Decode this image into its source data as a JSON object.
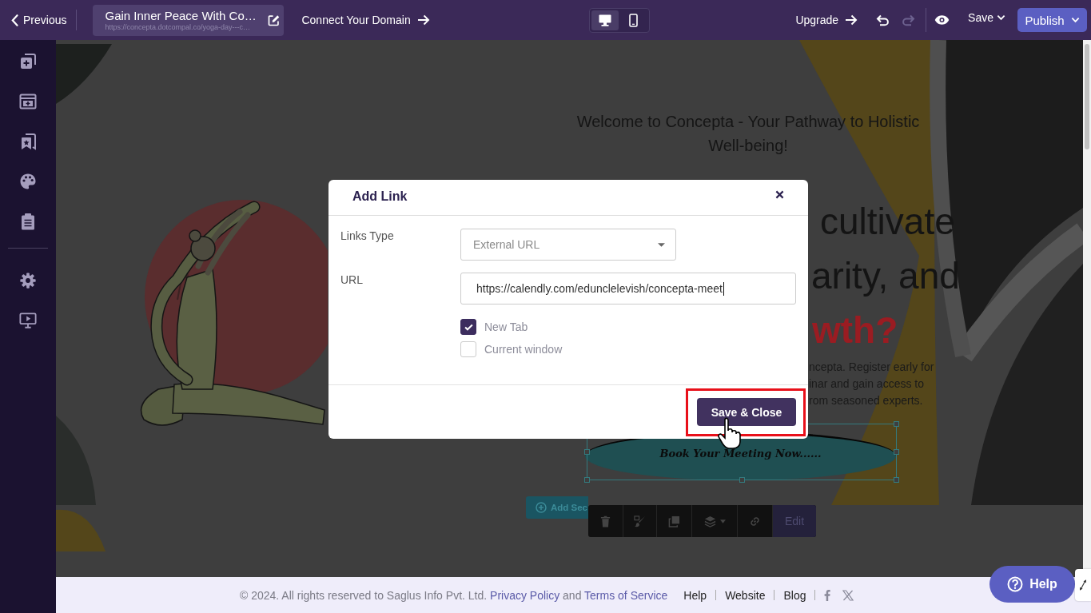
{
  "topbar": {
    "back": {
      "label": "Previous"
    },
    "page": {
      "title": "Gain Inner Peace With Co…",
      "url": "https://concepta.dotcompal.co/yoga-day---c…"
    },
    "domain_link": {
      "label": "Connect Your Domain"
    },
    "devices": [
      {
        "selected": true
      },
      {
        "selected": false
      }
    ],
    "upgrade": {
      "label": "Upgrade"
    },
    "history": [
      {
        "disabled": false
      },
      {
        "disabled": true
      }
    ],
    "save": {
      "label": "Save"
    },
    "publish": {
      "label": "Publish"
    }
  },
  "canvas": {
    "heading": "Welcome to Concepta - Your Pathway to Holistic Well-being!",
    "title_fragments": [
      {
        "kind": "plain",
        "text": "cultivate"
      },
      {
        "kind": "plain",
        "text": "arity, and"
      },
      {
        "kind": "accent",
        "text": "wth?"
      }
    ],
    "description_fragments": [
      "ncepta. Register early for",
      "inar and gain access to",
      "rom seasoned experts."
    ],
    "cta": {
      "label": "Book Your Meeting Now......",
      "selected": true
    },
    "add_section": {
      "label": "Add Sec"
    },
    "edit_button": {
      "label": "Edit"
    }
  },
  "modal": {
    "title": "Add Link",
    "fields": [
      {
        "kind": "select",
        "label": "Links Type",
        "value": "External URL"
      },
      {
        "kind": "text",
        "label": "URL",
        "value": "https://calendly.com/edunclelevish/concepta-meet"
      }
    ],
    "options": [
      {
        "label": "New Tab",
        "checked": true
      },
      {
        "label": "Current window",
        "checked": false
      }
    ],
    "primary_button": {
      "label": "Save & Close",
      "highlighted": true
    }
  },
  "footer": {
    "copyright": [
      {
        "kind": "text",
        "text": "© 2024. All rights reserved to Saglus Info Pvt. Ltd."
      },
      {
        "kind": "link",
        "text": "Privacy Policy"
      },
      {
        "kind": "text",
        "text": "and"
      },
      {
        "kind": "link",
        "text": "Terms of Service"
      }
    ],
    "links": [
      "Help",
      "Website",
      "Blog"
    ]
  },
  "help_button": {
    "label": "Help"
  }
}
